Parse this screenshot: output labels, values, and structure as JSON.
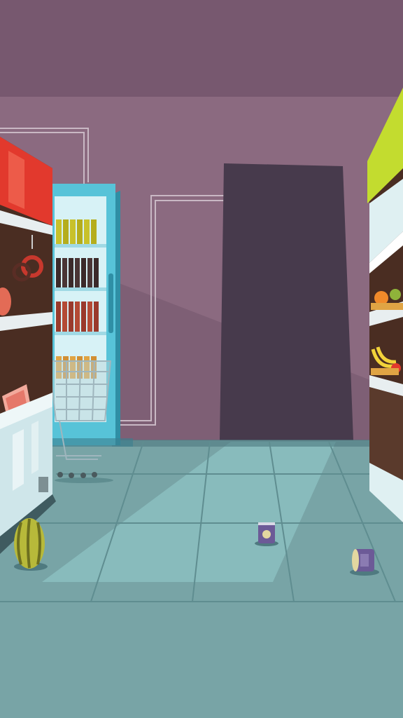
{
  "scene": {
    "description_visible_text": "",
    "colors": {
      "ceiling": "#77586f",
      "wall": "#8b6a80",
      "doorway": "#473a4c",
      "floor": "#78a4a6",
      "floor_light": "#8fc4c6",
      "shelf_red": "#e2392d",
      "shelf_lime": "#c3dc2f",
      "fridge_frame": "#57c3d8",
      "shelf_wood": "#4a2d22"
    },
    "icons": [
      "sausage-icon",
      "ham-icon",
      "meat-slab-icon",
      "watermelon-icon",
      "orange-icon",
      "banana-icon",
      "tomato-icon",
      "soda-can-icon",
      "shopping-cart-icon",
      "bottle-icon",
      "jar-icon"
    ]
  }
}
